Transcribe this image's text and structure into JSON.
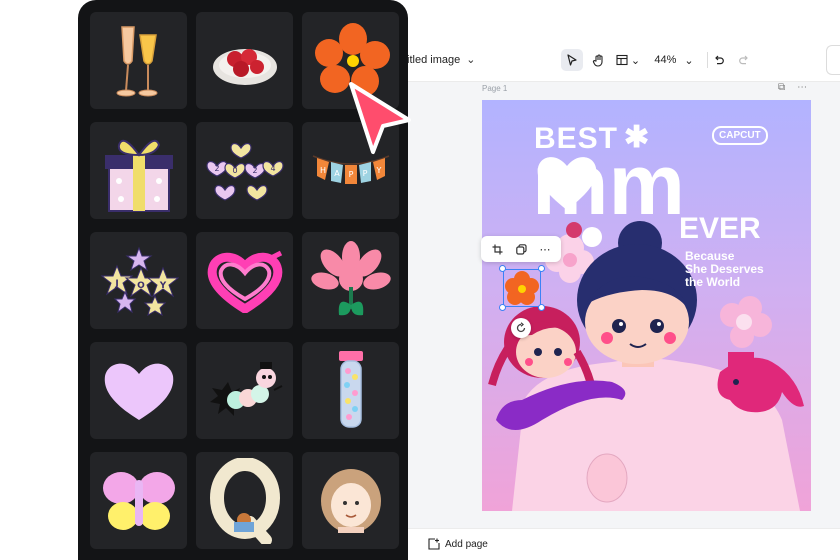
{
  "editor": {
    "document_title": "titled image",
    "zoom_level": "44%",
    "page_label": "Page 1",
    "add_page_label": "Add page"
  },
  "poster": {
    "brand": "CAPCUT",
    "headline_top": "BEST",
    "headline_main_left": "m",
    "headline_main_right": "m",
    "headline_bottom": "EVER",
    "tagline_line1": "Because",
    "tagline_line2": "She Deserves",
    "tagline_line3": "the World"
  },
  "sticker_panel": {
    "tiles": [
      "champagne-glasses",
      "strawberries-plate",
      "orange-flower",
      "gift-box",
      "heart-letters",
      "happy-banner",
      "joy-stars",
      "pink-scribble-heart",
      "pink-flower",
      "lilac-heart",
      "caterpillar",
      "candy-tube",
      "butterfly",
      "cloud-letter-q",
      "curly-hair-face"
    ],
    "joy_letters": [
      "J",
      "O",
      "Y"
    ],
    "happy_letters": [
      "H",
      "A",
      "P",
      "P",
      "Y"
    ],
    "heart_letters": [
      "2",
      "0",
      "2",
      "4"
    ]
  },
  "colors": {
    "panel_bg": "#131416",
    "tile_bg": "#232427",
    "accent_cursor": "#ff4d6d",
    "selection": "#3b82f6",
    "poster_top": "#b2b3ff",
    "poster_bottom": "#f0a3d8"
  }
}
